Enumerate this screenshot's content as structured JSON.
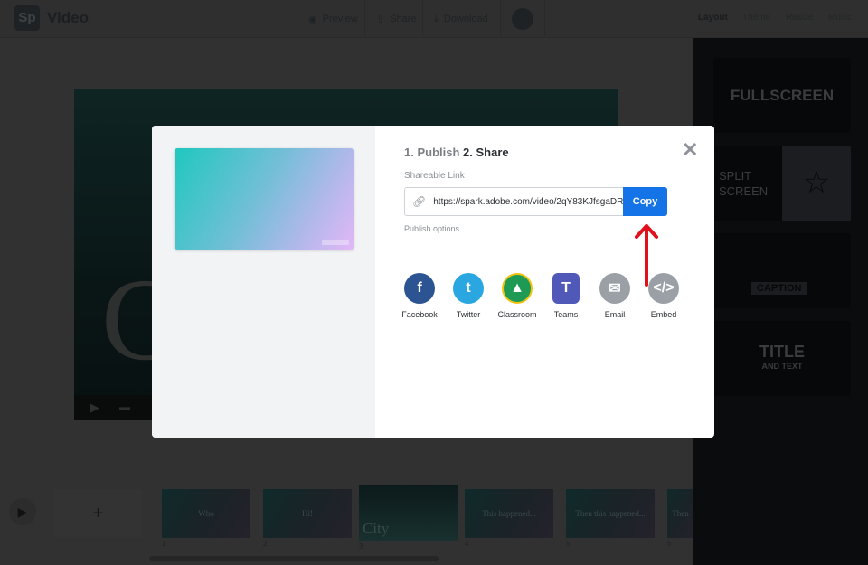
{
  "app": {
    "logo": "Sp",
    "title": "Video"
  },
  "toolbar": {
    "preview": "Preview",
    "share": "Share",
    "download": "Download"
  },
  "tabs": [
    "Layout",
    "Theme",
    "Resize",
    "Music"
  ],
  "layouts": {
    "fullscreen": "FULLSCREEN",
    "split1": "SPLIT",
    "split2": "SCREEN",
    "caption": "CAPTION",
    "title": "TITLE",
    "title_sub": "AND TEXT"
  },
  "canvas": {
    "big_letter": "C"
  },
  "modal": {
    "step1": "1. Publish",
    "step2": "2. Share",
    "link_label": "Shareable Link",
    "link": "https://spark.adobe.com/video/2qY83KJfsgaDR",
    "copy": "Copy",
    "publish_options": "Publish options",
    "watermark": "Adobe Spark",
    "share_targets": [
      {
        "label": "Facebook",
        "glyph": "f",
        "color": "#2d5492"
      },
      {
        "label": "Twitter",
        "glyph": "t",
        "color": "#2aa7e0"
      },
      {
        "label": "Classroom",
        "glyph": "▲",
        "color": "#1f9a55"
      },
      {
        "label": "Teams",
        "glyph": "T",
        "color": "#5058b8"
      },
      {
        "label": "Email",
        "glyph": "✉",
        "color": "#9aa0a6"
      },
      {
        "label": "Embed",
        "glyph": "</>",
        "color": "#9aa0a6"
      }
    ]
  },
  "filmstrip": {
    "add": "+",
    "slides": [
      {
        "text": "Who",
        "num": "1"
      },
      {
        "text": "Hi!",
        "num": "2"
      },
      {
        "text": "City",
        "num": "3"
      },
      {
        "text": "This happened...",
        "num": "4"
      },
      {
        "text": "Then this happened...",
        "num": "5"
      },
      {
        "text": "Then",
        "num": "6"
      }
    ]
  },
  "annotation": {
    "color": "#e0101c"
  }
}
